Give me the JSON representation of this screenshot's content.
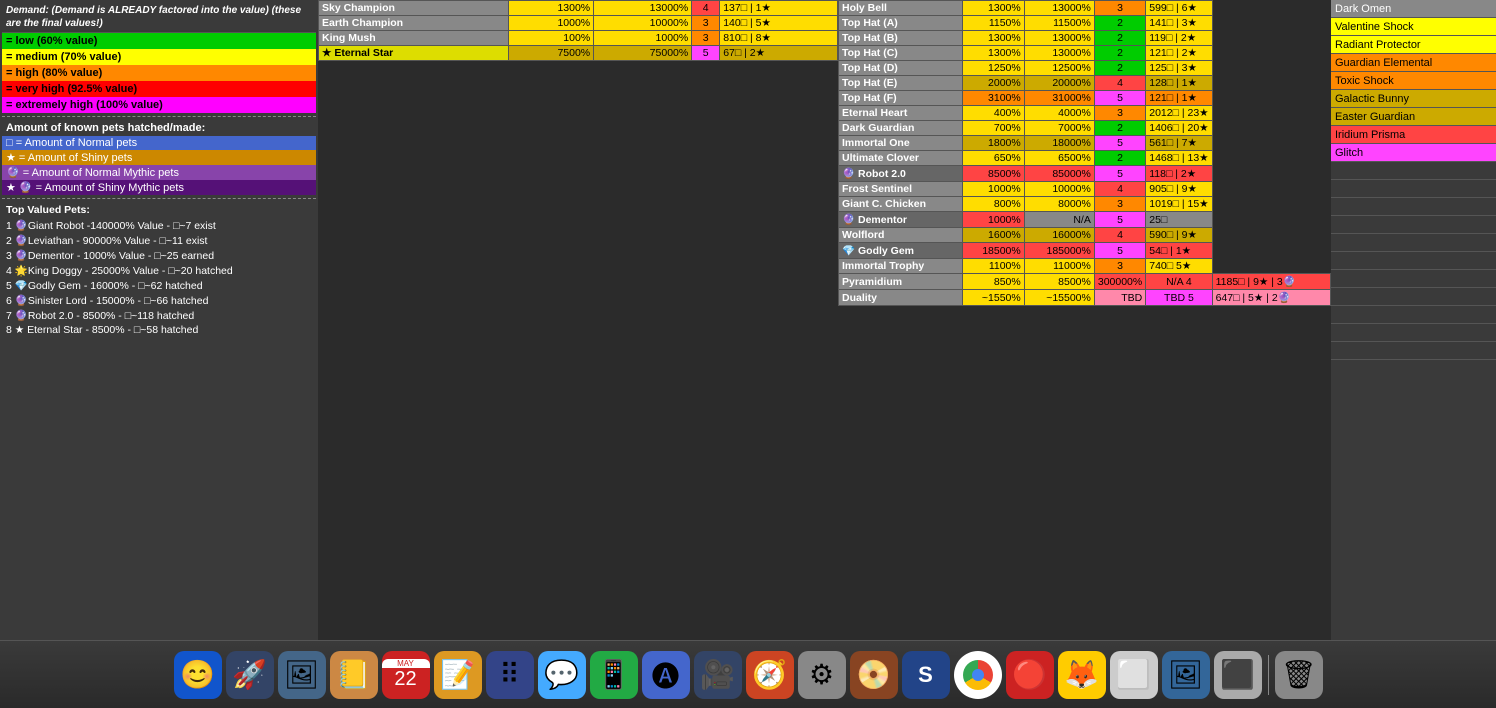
{
  "legend": {
    "demand_text": "Demand: (Demand is ALREADY factored into the value) (these are the final values!)",
    "colors": [
      {
        "label": "= low (60% value)",
        "class": "lc-green"
      },
      {
        "label": "= medium (70% value)",
        "class": "lc-yellow"
      },
      {
        "label": "= high (80% value)",
        "class": "lc-orange"
      },
      {
        "label": "= very high (92.5% value)",
        "class": "lc-red"
      },
      {
        "label": "= extremely high (100% value)",
        "class": "lc-magenta"
      }
    ],
    "hatched_title": "Amount of known pets hatched/made:",
    "amount_items": [
      {
        "label": "□ = Amount of Normal pets",
        "class": "li-blue"
      },
      {
        "label": "★ = Amount of Shiny pets",
        "class": "li-gold"
      },
      {
        "label": "🔮 = Amount of Normal Mythic pets",
        "class": "li-purple"
      },
      {
        "label": "★ 🔮 = Amount of Shiny Mythic pets",
        "class": "li-dark-purple"
      }
    ],
    "top_valued_title": "Top Valued Pets:",
    "top_valued": [
      {
        "label": "1 🔮Giant Robot -140000% Value - □~7 exist"
      },
      {
        "label": "2 🔮Leviathan - 90000% Value - □~11 exist"
      },
      {
        "label": "3 🔮Dementor - 1000% Value - □~25 earned"
      },
      {
        "label": "4 🌟King Doggy - 25000% Value - □~20 hatched"
      },
      {
        "label": "5 💎Godly Gem - 16000% - □~62 hatched"
      },
      {
        "label": "6 🔮Sinister Lord - 15000% - □~66 hatched"
      },
      {
        "label": "7 🔮Robot 2.0 - 8500% - □~118 hatched"
      },
      {
        "label": "8 ★ Eternal Star - 8500% - □~58 hatched"
      }
    ]
  },
  "mid_table": {
    "rows": [
      {
        "name": "Sky Champion",
        "pct1": "1300%",
        "pct2": "13000%",
        "num": "4",
        "count": "137□ | 1★",
        "c1": "cell-yellow",
        "c2": "cell-yellow",
        "cn": "cell-red",
        "cc": "cell-yellow"
      },
      {
        "name": "Earth Champion",
        "pct1": "1000%",
        "pct2": "10000%",
        "num": "3",
        "count": "140□ | 5★",
        "c1": "cell-yellow",
        "c2": "cell-yellow",
        "cn": "cell-orange",
        "cc": "cell-yellow"
      },
      {
        "name": "King Mush",
        "pct1": "100%",
        "pct2": "1000%",
        "num": "3",
        "count": "810□ | 8★",
        "c1": "cell-yellow",
        "c2": "cell-yellow",
        "cn": "cell-orange",
        "cc": "cell-yellow"
      },
      {
        "name": "★ Eternal Star",
        "pct1": "7500%",
        "pct2": "75000%",
        "num": "5",
        "count": "67□ | 2★",
        "c1": "cell-gold",
        "c2": "cell-gold",
        "cn": "cell-magenta",
        "cc": "cell-gold",
        "special": true
      }
    ]
  },
  "right_table": {
    "rows": [
      {
        "name": "Holy Bell",
        "pct1": "1300%",
        "pct2": "13000%",
        "num": "3",
        "count": "599□ | 6★",
        "c1": "cell-yellow",
        "c2": "cell-yellow",
        "cn": "cell-orange",
        "cc": "cell-yellow"
      },
      {
        "name": "Top Hat (A)",
        "pct1": "1150%",
        "pct2": "11500%",
        "num": "2",
        "count": "141□ | 3★",
        "c1": "cell-yellow",
        "c2": "cell-yellow",
        "cn": "cell-green",
        "cc": "cell-yellow"
      },
      {
        "name": "Top Hat (B)",
        "pct1": "1300%",
        "pct2": "13000%",
        "num": "2",
        "count": "119□ | 2★",
        "c1": "cell-yellow",
        "c2": "cell-yellow",
        "cn": "cell-green",
        "cc": "cell-yellow"
      },
      {
        "name": "Top Hat (C)",
        "pct1": "1300%",
        "pct2": "13000%",
        "num": "2",
        "count": "121□ | 2★",
        "c1": "cell-yellow",
        "c2": "cell-yellow",
        "cn": "cell-green",
        "cc": "cell-yellow"
      },
      {
        "name": "Top Hat (D)",
        "pct1": "1250%",
        "pct2": "12500%",
        "num": "2",
        "count": "125□ | 3★",
        "c1": "cell-yellow",
        "c2": "cell-yellow",
        "cn": "cell-green",
        "cc": "cell-yellow"
      },
      {
        "name": "Top Hat (E)",
        "pct1": "2000%",
        "pct2": "20000%",
        "num": "4",
        "count": "128□ | 1★",
        "c1": "cell-gold",
        "c2": "cell-gold",
        "cn": "cell-red",
        "cc": "cell-gold"
      },
      {
        "name": "Top Hat (F)",
        "pct1": "3100%",
        "pct2": "31000%",
        "num": "5",
        "count": "121□ | 1★",
        "c1": "cell-orange",
        "c2": "cell-orange",
        "cn": "cell-magenta",
        "cc": "cell-orange"
      },
      {
        "name": "Eternal Heart",
        "pct1": "400%",
        "pct2": "4000%",
        "num": "3",
        "count": "2012□ | 23★",
        "c1": "cell-yellow",
        "c2": "cell-yellow",
        "cn": "cell-orange",
        "cc": "cell-yellow"
      },
      {
        "name": "Dark Guardian",
        "pct1": "700%",
        "pct2": "7000%",
        "num": "2",
        "count": "1406□ | 20★",
        "c1": "cell-yellow",
        "c2": "cell-yellow",
        "cn": "cell-green",
        "cc": "cell-yellow"
      },
      {
        "name": "Immortal One",
        "pct1": "1800%",
        "pct2": "18000%",
        "num": "5",
        "count": "561□ | 7★",
        "c1": "cell-gold",
        "c2": "cell-gold",
        "cn": "cell-magenta",
        "cc": "cell-gold"
      },
      {
        "name": "Ultimate Clover",
        "pct1": "650%",
        "pct2": "6500%",
        "num": "2",
        "count": "1468□ | 13★",
        "c1": "cell-yellow",
        "c2": "cell-yellow",
        "cn": "cell-green",
        "cc": "cell-yellow"
      },
      {
        "name": "🔮 Robot 2.0",
        "pct1": "8500%",
        "pct2": "85000%",
        "num": "5",
        "count": "118□ | 2★",
        "c1": "cell-red",
        "c2": "cell-red",
        "cn": "cell-magenta",
        "cc": "cell-red"
      },
      {
        "name": "Frost Sentinel",
        "pct1": "1000%",
        "pct2": "10000%",
        "num": "4",
        "count": "905□ | 9★",
        "c1": "cell-yellow",
        "c2": "cell-yellow",
        "cn": "cell-red",
        "cc": "cell-yellow"
      },
      {
        "name": "Giant C. Chicken",
        "pct1": "800%",
        "pct2": "8000%",
        "num": "3",
        "count": "1019□ | 15★",
        "c1": "cell-yellow",
        "c2": "cell-yellow",
        "cn": "cell-orange",
        "cc": "cell-yellow"
      },
      {
        "name": "🔮 Dementor",
        "pct1": "1000%",
        "pct2": "N/A",
        "num": "5",
        "count": "25□",
        "c1": "cell-red",
        "c2": "cell-gray",
        "cn": "cell-magenta",
        "cc": "cell-gray"
      },
      {
        "name": "Wolflord",
        "pct1": "1600%",
        "pct2": "16000%",
        "num": "4",
        "count": "590□ | 9★",
        "c1": "cell-gold",
        "c2": "cell-gold",
        "cn": "cell-red",
        "cc": "cell-gold"
      },
      {
        "name": "💎 Godly Gem",
        "pct1": "18500%",
        "pct2": "185000%",
        "num": "5",
        "count": "54□ | 1★",
        "c1": "cell-red",
        "c2": "cell-red",
        "cn": "cell-magenta",
        "cc": "cell-red"
      },
      {
        "name": "Immortal Trophy",
        "pct1": "1100%",
        "pct2": "11000%",
        "num": "3",
        "count": "740□ 5★",
        "c1": "cell-yellow",
        "c2": "cell-yellow",
        "cn": "cell-orange",
        "cc": "cell-yellow"
      },
      {
        "name": "Pyramidium",
        "pct1": "850%",
        "pct2": "8500%",
        "pct3": "300000%",
        "num": "N/A",
        "numv": "4",
        "count": "1185□ | 9★ | 3🔮",
        "c1": "cell-yellow",
        "c2": "cell-yellow",
        "cn": "cell-red",
        "cc": "cell-red",
        "special2": true
      },
      {
        "name": "Duality",
        "pct1": "~1550%",
        "pct2": "~15500%",
        "pct3": "TBD",
        "num": "TBD",
        "numv": "5",
        "count": "647□ | 5★ | 2🔮",
        "c1": "cell-yellow",
        "c2": "cell-yellow",
        "cn": "cell-magenta",
        "cc": "cell-pink",
        "special2": true
      }
    ]
  },
  "far_right": {
    "items": [
      {
        "label": "Dark Omen",
        "rowClass": "fr-row-gray"
      },
      {
        "label": "Valentine Shock",
        "rowClass": "fr-row-yellow"
      },
      {
        "label": "Radiant Protector",
        "rowClass": "fr-row-yellow"
      },
      {
        "label": "Guardian Elemental",
        "rowClass": "fr-row-orange"
      },
      {
        "label": "Toxic Shock",
        "rowClass": "fr-row-orange"
      },
      {
        "label": "Galactic Bunny",
        "rowClass": "fr-row-gold"
      },
      {
        "label": "Easter Guardian",
        "rowClass": "fr-row-gold"
      },
      {
        "label": "Iridium Prisma",
        "rowClass": "fr-row-red"
      },
      {
        "label": "Glitch",
        "rowClass": "fr-row-magenta"
      },
      {
        "label": "",
        "rowClass": "fr-row-empty"
      },
      {
        "label": "",
        "rowClass": "fr-row-empty"
      },
      {
        "label": "",
        "rowClass": "fr-row-empty"
      },
      {
        "label": "",
        "rowClass": "fr-row-empty"
      },
      {
        "label": "",
        "rowClass": "fr-row-empty"
      },
      {
        "label": "",
        "rowClass": "fr-row-empty"
      },
      {
        "label": "",
        "rowClass": "fr-row-empty"
      },
      {
        "label": "",
        "rowClass": "fr-row-empty"
      },
      {
        "label": "",
        "rowClass": "fr-row-empty"
      },
      {
        "label": "",
        "rowClass": "fr-row-empty"
      },
      {
        "label": "",
        "rowClass": "fr-row-empty"
      }
    ]
  },
  "dock": {
    "icons": [
      {
        "symbol": "😊",
        "bg": "#5588ff",
        "label": "finder"
      },
      {
        "symbol": "🚀",
        "bg": "#334466",
        "label": "launchpad"
      },
      {
        "symbol": "🖼️",
        "bg": "#446688",
        "label": "photos"
      },
      {
        "symbol": "📔",
        "bg": "#cc8844",
        "label": "contacts"
      },
      {
        "symbol": "22",
        "bg": "#cc2222",
        "label": "calendar",
        "isDate": true
      },
      {
        "symbol": "📝",
        "bg": "#ffcc44",
        "label": "stickies"
      },
      {
        "symbol": "⋮",
        "bg": "#334488",
        "label": "reminders"
      },
      {
        "symbol": "💬",
        "bg": "#44aaff",
        "label": "messages"
      },
      {
        "symbol": "📹",
        "bg": "#22aa44",
        "label": "facetime"
      },
      {
        "symbol": "🅐",
        "bg": "#4466cc",
        "label": "appstore"
      },
      {
        "symbol": "📷",
        "bg": "#334466",
        "label": "zoom"
      },
      {
        "symbol": "🧭",
        "bg": "#cc4422",
        "label": "safari"
      },
      {
        "symbol": "⚙️",
        "bg": "#888888",
        "label": "systemprefs"
      },
      {
        "symbol": "📀",
        "bg": "#884422",
        "label": "dvdplayer"
      },
      {
        "symbol": "S",
        "bg": "#224488",
        "label": "skype"
      },
      {
        "symbol": "🌐",
        "bg": "#cc3322",
        "label": "chrome"
      },
      {
        "symbol": "⭕",
        "bg": "#cc2222",
        "label": "opera"
      },
      {
        "symbol": "⭕",
        "bg": "#ffcc00",
        "label": "firefox"
      },
      {
        "symbol": "□",
        "bg": "#cccccc",
        "label": "app1"
      },
      {
        "symbol": "🖼",
        "bg": "#336699",
        "label": "preview"
      },
      {
        "symbol": "□",
        "bg": "#aaaaaa",
        "label": "app2"
      },
      {
        "symbol": "🗑️",
        "bg": "#888888",
        "label": "trash"
      }
    ]
  }
}
